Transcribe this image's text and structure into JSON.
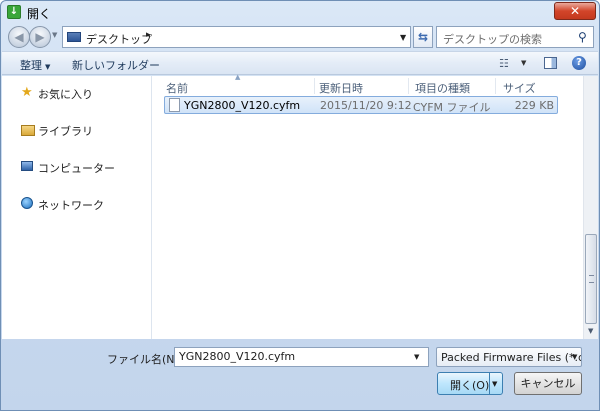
{
  "window": {
    "title": "開く"
  },
  "nav": {
    "address": "デスクトップ",
    "address_separator": "▸",
    "search_placeholder": "デスクトップの検索"
  },
  "toolbar": {
    "organize_label": "整理",
    "new_folder_label": "新しいフォルダー"
  },
  "sidebar": {
    "items": [
      {
        "label": "お気に入り",
        "icon": "star-icon"
      },
      {
        "label": "ライブラリ",
        "icon": "library-icon"
      },
      {
        "label": "コンピューター",
        "icon": "computer-icon"
      },
      {
        "label": "ネットワーク",
        "icon": "network-icon"
      }
    ]
  },
  "files": {
    "columns": [
      "名前",
      "更新日時",
      "項目の種類",
      "サイズ"
    ],
    "rows": [
      {
        "name": "YGN2800_V120.cyfm",
        "date": "2015/11/20 9:12",
        "type": "CYFM ファイル",
        "size": "229 KB"
      }
    ]
  },
  "footer": {
    "filename_label": "ファイル名(N):",
    "filename_value": "YGN2800_V120.cyfm",
    "filter_value": "Packed Firmware Files (*.cy",
    "open_label": "開く(O)",
    "cancel_label": "キャンセル"
  },
  "colors": {
    "accent": "#3c7fb1",
    "selection": "#d0e3f8",
    "close": "#c4391f"
  }
}
